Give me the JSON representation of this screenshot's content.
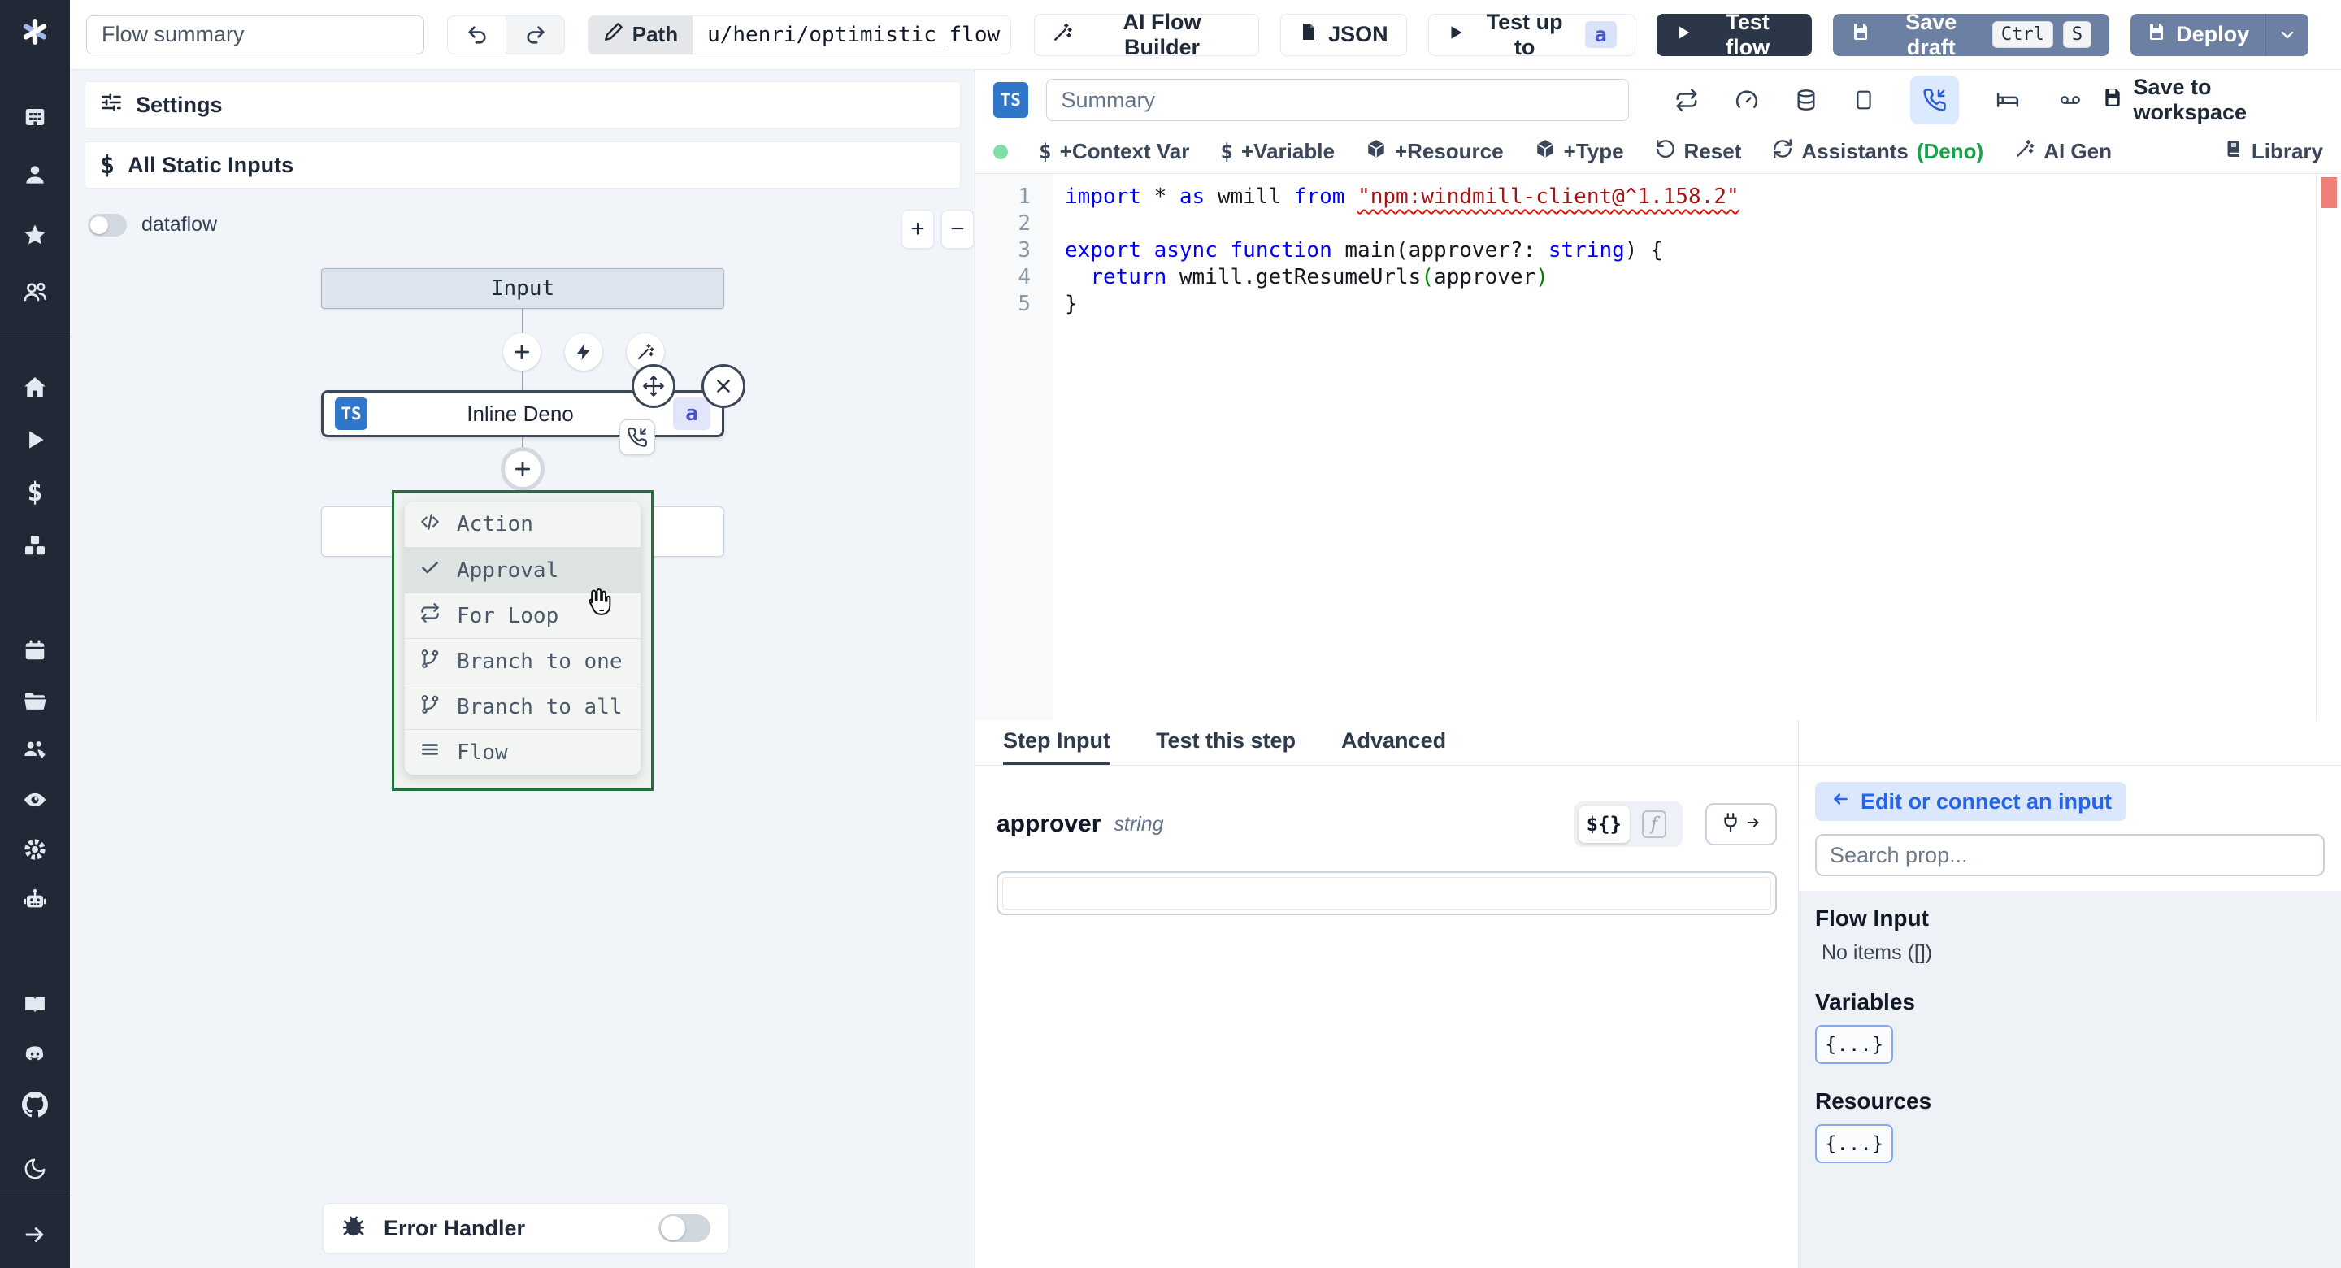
{
  "topbar": {
    "flow_summary_placeholder": "Flow summary",
    "path_label": "Path",
    "path_value": "u/henri/optimistic_flow",
    "ai_flow_builder": "AI Flow Builder",
    "json_button": "JSON",
    "test_up_to": "Test up to",
    "test_up_to_badge": "a",
    "test_flow": "Test flow",
    "save_draft": "Save draft",
    "save_draft_kbd": [
      "Ctrl",
      "S"
    ],
    "deploy": "Deploy"
  },
  "sidebar": {
    "icons": [
      "windmill-logo",
      "apps",
      "user",
      "star",
      "users",
      "home",
      "runs",
      "variables",
      "resources",
      "schedules",
      "folders",
      "groups",
      "audit-logs",
      "workers",
      "workspace-ai",
      "docs",
      "discord",
      "github",
      "dark-mode",
      "expand"
    ]
  },
  "flow_panel": {
    "settings_label": "Settings",
    "all_static_inputs_label": "All Static Inputs",
    "dataflow_label": "dataflow",
    "zoom_in": "+",
    "zoom_out": "−",
    "input_node_label": "Input",
    "step_node": {
      "badge": "TS",
      "label": "Inline Deno",
      "id_badge": "a"
    },
    "insert_menu": {
      "items": [
        {
          "label": "Action",
          "icon": "code-icon"
        },
        {
          "label": "Approval",
          "icon": "check-icon",
          "highlighted": true
        },
        {
          "label": "For Loop",
          "icon": "repeat-icon"
        },
        {
          "label": "Branch to one",
          "icon": "git-branch-icon"
        },
        {
          "label": "Branch to all",
          "icon": "git-branch-icon"
        },
        {
          "label": "Flow",
          "icon": "flow-icon"
        }
      ]
    },
    "error_handler_label": "Error Handler"
  },
  "editor_header": {
    "lang_badge": "TS",
    "summary_placeholder": "Summary",
    "icons": [
      "retries",
      "early-stop",
      "cache",
      "script-box",
      "suspend-approval",
      "sleep",
      "mock"
    ],
    "save_to_workspace": "Save to workspace",
    "context_var": "+Context Var",
    "variable": "+Variable",
    "resource": "+Resource",
    "type": "+Type",
    "reset": "Reset",
    "assistants": "Assistants",
    "assistants_lang": "(Deno)",
    "ai_gen": "AI Gen",
    "library": "Library"
  },
  "editor": {
    "line_numbers": [
      "1",
      "2",
      "3",
      "4",
      "5"
    ],
    "lines": [
      [
        {
          "t": "import",
          "c": "kw"
        },
        {
          "t": " * ",
          "c": "p"
        },
        {
          "t": "as",
          "c": "kw"
        },
        {
          "t": " wmill ",
          "c": "p"
        },
        {
          "t": "from",
          "c": "kw"
        },
        {
          "t": " ",
          "c": "p"
        },
        {
          "t": "\"npm:windmill-client@^1.158.2\"",
          "c": "strsq"
        }
      ],
      [],
      [
        {
          "t": "export",
          "c": "kw"
        },
        {
          "t": " ",
          "c": "p"
        },
        {
          "t": "async",
          "c": "kw"
        },
        {
          "t": " ",
          "c": "p"
        },
        {
          "t": "function",
          "c": "kw"
        },
        {
          "t": " main(approver?: ",
          "c": "p"
        },
        {
          "t": "string",
          "c": "kw"
        },
        {
          "t": ") {",
          "c": "p"
        }
      ],
      [
        {
          "t": "  ",
          "c": "p"
        },
        {
          "t": "return",
          "c": "kw"
        },
        {
          "t": " wmill.getResumeUrls",
          "c": "p"
        },
        {
          "t": "(",
          "c": "grn"
        },
        {
          "t": "approver",
          "c": "p"
        },
        {
          "t": ")",
          "c": "grn"
        }
      ],
      [
        {
          "t": "}",
          "c": "p"
        }
      ]
    ]
  },
  "step_panel": {
    "tabs": [
      {
        "label": "Step Input",
        "active": true
      },
      {
        "label": "Test this step",
        "active": false
      },
      {
        "label": "Advanced",
        "active": false
      }
    ],
    "prop_name": "approver",
    "prop_type": "string",
    "toggle_expr": "${}",
    "toggle_fn": "f",
    "arg_value": ""
  },
  "props_panel": {
    "edit_connect_label": "Edit or connect an input",
    "search_placeholder": "Search prop...",
    "flow_input_title": "Flow Input",
    "flow_input_empty": "No items ([])",
    "variables_title": "Variables",
    "variables_chip": "{...}",
    "resources_title": "Resources",
    "resources_chip": "{...}"
  }
}
